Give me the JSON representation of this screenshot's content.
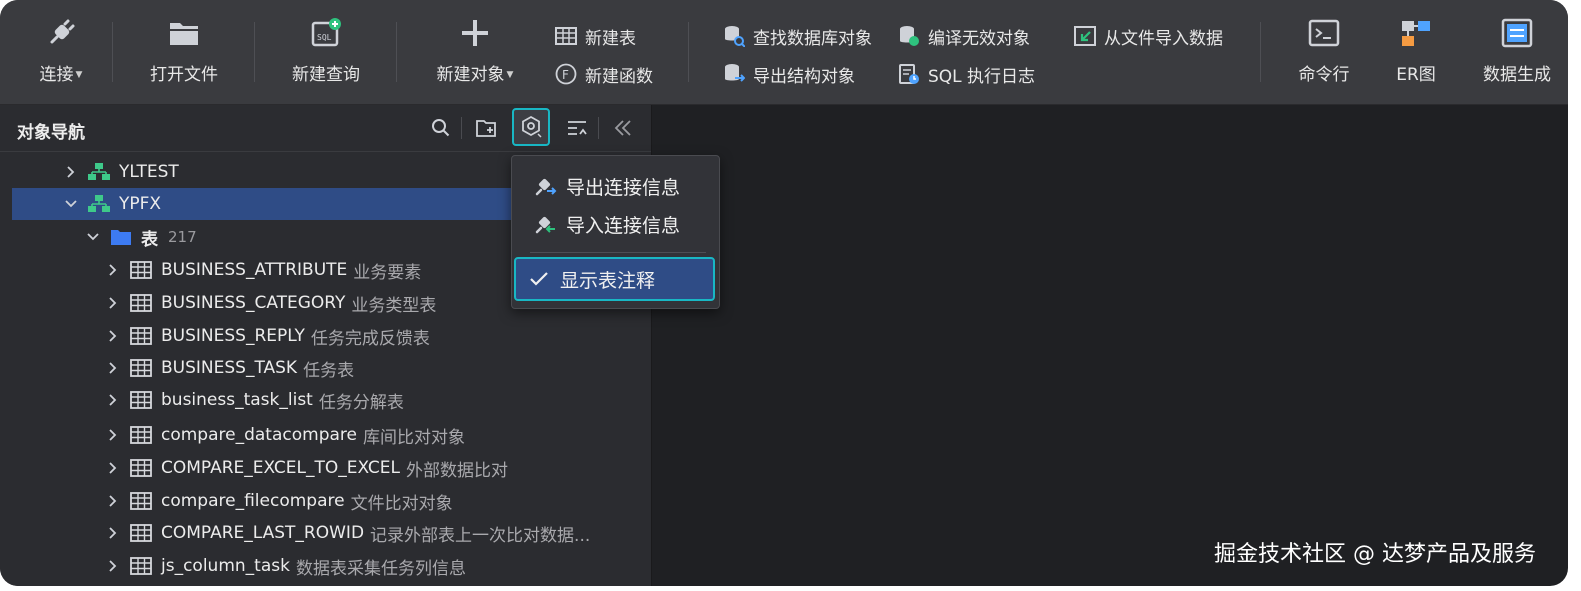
{
  "toolbar": {
    "connect": "连接",
    "open_file": "打开文件",
    "new_query": "新建查询",
    "new_object": "新建对象",
    "new_table": "新建表",
    "new_function": "新建函数",
    "find_db_object": "查找数据库对象",
    "export_structure": "导出结构对象",
    "compile_invalid": "编译无效对象",
    "sql_log": "SQL 执行日志",
    "import_from_file": "从文件导入数据",
    "command_line": "命令行",
    "er_diagram": "ER图",
    "data_generate": "数据生成"
  },
  "navigator": {
    "title": "对象导航",
    "tree": [
      {
        "name": "YLTEST",
        "comment": "",
        "expanded": false
      },
      {
        "name": "YPFX",
        "comment": "",
        "expanded": true,
        "selected": true
      },
      {
        "name": "表",
        "count": "217",
        "expanded": true
      },
      {
        "name": "BUSINESS_ATTRIBUTE",
        "comment": "业务要素"
      },
      {
        "name": "BUSINESS_CATEGORY",
        "comment": "业务类型表"
      },
      {
        "name": "BUSINESS_REPLY",
        "comment": "任务完成反馈表"
      },
      {
        "name": "BUSINESS_TASK",
        "comment": "任务表"
      },
      {
        "name": "business_task_list",
        "comment": "任务分解表"
      },
      {
        "name": "compare_datacompare",
        "comment": "库间比对对象"
      },
      {
        "name": "COMPARE_EXCEL_TO_EXCEL",
        "comment": "外部数据比对"
      },
      {
        "name": "compare_filecompare",
        "comment": "文件比对对象"
      },
      {
        "name": "COMPARE_LAST_ROWID",
        "comment": "记录外部表上一次比对数据..."
      },
      {
        "name": "js_column_task",
        "comment": "数据表采集任务列信息"
      }
    ]
  },
  "menu": {
    "export_conn": "导出连接信息",
    "import_conn": "导入连接信息",
    "show_comments": "显示表注释"
  },
  "watermark": "掘金技术社区 @ 达梦产品及服务",
  "colors": {
    "accent_border": "#19b7c4",
    "selection": "#2f4c86",
    "folder": "#3d7bf2"
  }
}
